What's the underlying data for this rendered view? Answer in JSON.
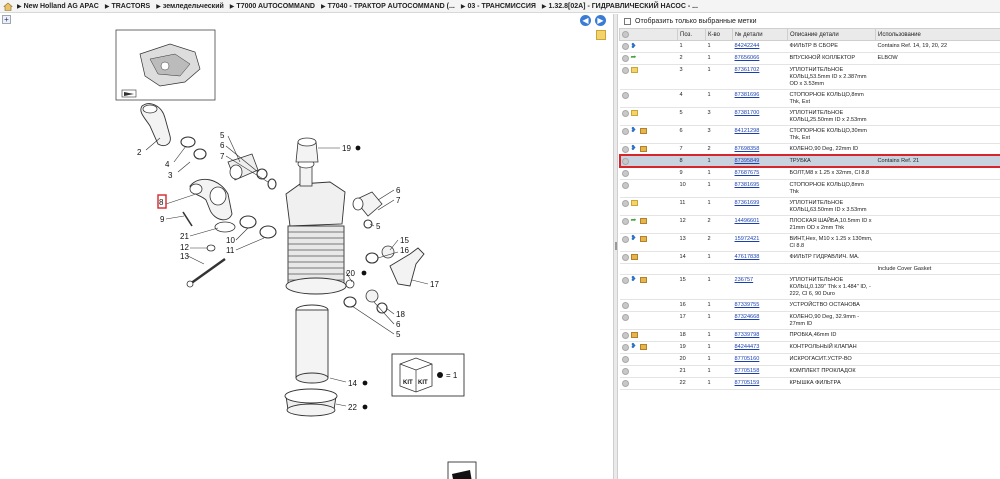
{
  "breadcrumb": {
    "items": [
      "New Holland AG APAC",
      "TRACTORS",
      "земледельческий",
      "T7000 AUTOCOMMAND",
      "T7040 - ТРАКТОР AUTOCOMMAND (...",
      "03 - ТРАНСМИССИЯ",
      "1.32.8[02A] - ГИДРАВЛИЧЕСКИЙ НАСОС - ..."
    ]
  },
  "toolbar": {
    "zoom_label": "+",
    "prev_label": "◀",
    "next_label": "▶"
  },
  "filter": {
    "label": "Отобразить только выбранные метки"
  },
  "table": {
    "headers": {
      "pos": "Поз.",
      "qty": "К-во",
      "part": "№ детали",
      "desc": "Описание детали",
      "usage": "Использование"
    },
    "rows": [
      {
        "pos": "1",
        "qty": "1",
        "part": "84242244",
        "desc": "ФИЛЬТР В СБОРЕ",
        "usage": "Contains Ref. 14, 19, 20, 22",
        "icons": [
          "info",
          "eye"
        ]
      },
      {
        "pos": "2",
        "qty": "1",
        "part": "87656066",
        "desc": "ВПУСКНОЙ КОЛЛЕКТОР",
        "usage": "ELBOW",
        "icons": [
          "info",
          "arrow"
        ]
      },
      {
        "pos": "3",
        "qty": "1",
        "part": "87361702",
        "desc": "УПЛОТНИТЕЛЬНОЕ КОЛЬЦ,53.5mm ID x 2.387mm OD x 3.53mm",
        "usage": "",
        "icons": [
          "info",
          "note"
        ]
      },
      {
        "pos": "4",
        "qty": "1",
        "part": "87381696",
        "desc": "СТОПОРНОЕ КОЛЬЦО,8mm Thk, Ext",
        "usage": "",
        "icons": [
          "info"
        ]
      },
      {
        "pos": "5",
        "qty": "3",
        "part": "87381700",
        "desc": "УПЛОТНИТЕЛЬНОЕ КОЛЬЦ,25.50mm ID x 2.53mm",
        "usage": "",
        "icons": [
          "info",
          "note"
        ]
      },
      {
        "pos": "6",
        "qty": "3",
        "part": "84121298",
        "desc": "СТОПОРНОЕ КОЛЬЦО,30mm Thk, Ext",
        "usage": "",
        "icons": [
          "info",
          "eye",
          "box"
        ]
      },
      {
        "pos": "7",
        "qty": "2",
        "part": "87698358",
        "desc": "КОЛЕНО,90 Deg, 22mm ID",
        "usage": "",
        "icons": [
          "info",
          "eye",
          "box"
        ]
      },
      {
        "pos": "8",
        "qty": "1",
        "part": "87395849",
        "desc": "ТРУБКА",
        "usage": "Contains Ref. 21",
        "icons": [
          "info"
        ],
        "selected": true
      },
      {
        "pos": "9",
        "qty": "1",
        "part": "87687675",
        "desc": "БОЛТ,M8 x 1.25 x 32mm, Cl 8.8",
        "usage": "",
        "icons": [
          "info"
        ]
      },
      {
        "pos": "10",
        "qty": "1",
        "part": "87381695",
        "desc": "СТОПОРНОЕ КОЛЬЦО,8mm Thk",
        "usage": "",
        "icons": [
          "info"
        ]
      },
      {
        "pos": "11",
        "qty": "1",
        "part": "87361699",
        "desc": "УПЛОТНИТЕЛЬНОЕ КОЛЬЦ,63.50mm ID x 3.53mm",
        "usage": "",
        "icons": [
          "info",
          "note"
        ]
      },
      {
        "pos": "12",
        "qty": "2",
        "part": "14496601",
        "desc": "ПЛОСКАЯ ШАЙБА,10.5mm ID x 21mm OD x 2mm Thk",
        "usage": "",
        "icons": [
          "info",
          "arrow",
          "box"
        ]
      },
      {
        "pos": "13",
        "qty": "2",
        "part": "15972421",
        "desc": "ВИНТ,Hex, M10 x 1.25 x 130mm, Cl 8.8",
        "usage": "",
        "icons": [
          "info",
          "eye",
          "box"
        ]
      },
      {
        "pos": "14",
        "qty": "1",
        "part": "47617838",
        "desc": "ФИЛЬТР ГИДРАВЛИЧ. МА.",
        "usage": "",
        "icons": [
          "info",
          "box"
        ]
      },
      {
        "pos": "",
        "qty": "",
        "part": "",
        "desc": "",
        "usage": "Include Cover Gasket",
        "icons": []
      },
      {
        "pos": "15",
        "qty": "1",
        "part": "236757",
        "desc": "УПЛОТНИТЕЛЬНОЕ КОЛЬЦ,0.139\" Thk x 1.484\" ID, - 222, Cl 6, 90 Duro",
        "usage": "",
        "icons": [
          "info",
          "eye",
          "box"
        ]
      },
      {
        "pos": "16",
        "qty": "1",
        "part": "87339755",
        "desc": "УСТРОЙСТВО ОСТАНОВА",
        "usage": "",
        "icons": [
          "info"
        ]
      },
      {
        "pos": "17",
        "qty": "1",
        "part": "87324668",
        "desc": "КОЛЕНО,90 Deg, 32.9mm - 27mm ID",
        "usage": "",
        "icons": [
          "info"
        ]
      },
      {
        "pos": "18",
        "qty": "1",
        "part": "87339798",
        "desc": "ПРОБКА,46mm ID",
        "usage": "",
        "icons": [
          "info",
          "box"
        ]
      },
      {
        "pos": "19",
        "qty": "1",
        "part": "84244473",
        "desc": "КОНТРОЛЬНЫЙ КЛАПАН",
        "usage": "",
        "icons": [
          "info",
          "eye",
          "box"
        ]
      },
      {
        "pos": "20",
        "qty": "1",
        "part": "87705160",
        "desc": "ИСКРОГАСИТ.УСТР-ВО",
        "usage": "",
        "icons": [
          "info"
        ]
      },
      {
        "pos": "21",
        "qty": "1",
        "part": "87705158",
        "desc": "КОМПЛЕКТ ПРОКЛАДОК",
        "usage": "",
        "icons": [
          "info"
        ]
      },
      {
        "pos": "22",
        "qty": "1",
        "part": "87705159",
        "desc": "КРЫШКА ФИЛЬТРА",
        "usage": "",
        "icons": [
          "info"
        ]
      }
    ]
  },
  "diagram": {
    "callouts": [
      "2",
      "3",
      "4",
      "5",
      "6",
      "7",
      "8",
      "9",
      "10",
      "11",
      "12",
      "13",
      "14",
      "15",
      "16",
      "17",
      "18",
      "19",
      "20",
      "21",
      "22"
    ],
    "highlight_callout": "8",
    "kit_legend": "= 1"
  },
  "colors": {
    "selected_row": "#c9d3e0",
    "highlight_border": "#d6262b",
    "link": "#1a3fb0"
  }
}
